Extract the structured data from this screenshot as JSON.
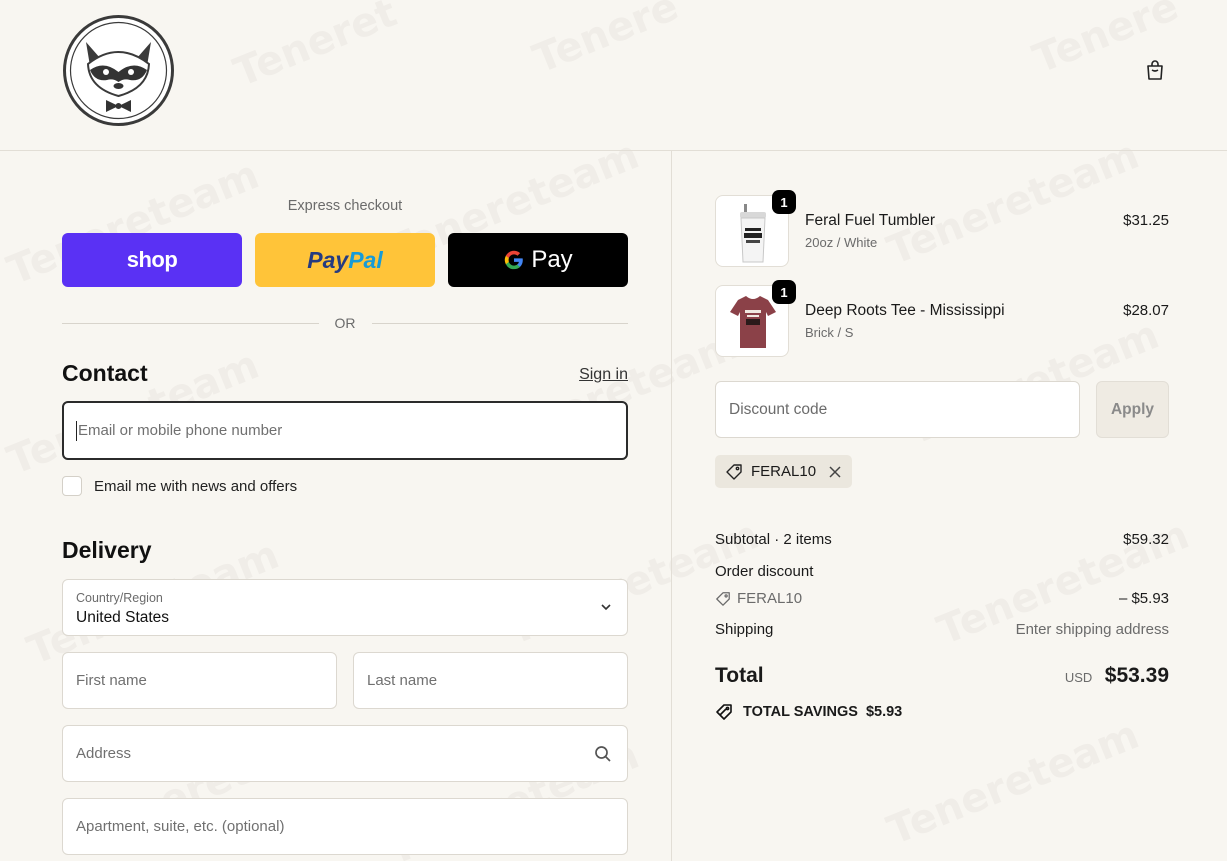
{
  "header": {
    "logo_icon": "raccoon-bowtie-logo",
    "cart_icon": "shopping-bag-icon"
  },
  "express": {
    "label": "Express checkout",
    "shop_label": "shop",
    "paypal_part1": "Pay",
    "paypal_part2": "Pal",
    "gpay_label": "Pay",
    "or_label": "OR"
  },
  "contact": {
    "title": "Contact",
    "sign_in": "Sign in",
    "email_placeholder": "Email or mobile phone number",
    "newsletter_label": "Email me with news and offers"
  },
  "delivery": {
    "title": "Delivery",
    "country_label": "Country/Region",
    "country_value": "United States",
    "first_name_placeholder": "First name",
    "last_name_placeholder": "Last name",
    "address_placeholder": "Address",
    "apartment_placeholder": "Apartment, suite, etc. (optional)"
  },
  "cart": {
    "items": [
      {
        "name": "Feral Fuel Tumbler",
        "variant": "20oz / White",
        "price": "$31.25",
        "qty": "1"
      },
      {
        "name": "Deep Roots Tee - Mississippi",
        "variant": "Brick / S",
        "price": "$28.07",
        "qty": "1"
      }
    ],
    "discount_placeholder": "Discount code",
    "apply_label": "Apply",
    "applied_code": "FERAL10"
  },
  "summary": {
    "subtotal_label": "Subtotal · 2 items",
    "subtotal_value": "$59.32",
    "order_discount_label": "Order discount",
    "discount_code": "FERAL10",
    "discount_value": "– $5.93",
    "shipping_label": "Shipping",
    "shipping_value": "Enter shipping address",
    "total_label": "Total",
    "currency": "USD",
    "total_value": "$53.39",
    "savings_label": "TOTAL SAVINGS",
    "savings_value": "$5.93"
  },
  "colors": {
    "shop_pay": "#5a31f4",
    "paypal": "#ffc439",
    "gpay": "#000000",
    "background": "#f8f6f1"
  }
}
